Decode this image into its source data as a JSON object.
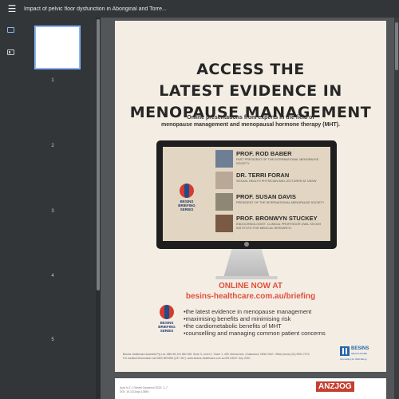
{
  "toolbar": {
    "title": "Impact of pelvic floor dysfunction in Aboriginal and Torre...",
    "menu_icon": "menu-icon"
  },
  "sidebar": {
    "thumbnail_icon": "thumbnail-view-icon",
    "outline_icon": "document-outline-icon",
    "page_numbers": [
      "1",
      "2",
      "3",
      "4",
      "5"
    ]
  },
  "ad": {
    "headline_1": "ACCESS THE",
    "headline_2": "LATEST EVIDENCE IN",
    "headline_3": "MENOPAUSE MANAGEMENT",
    "subhead_1": "Online presentations from experts in the field of",
    "subhead_2": "menopause management and menopausal hormone therapy (MHT).",
    "series_logo": [
      "BESINS",
      "BRIEFING",
      "SERIES"
    ],
    "speakers": [
      {
        "name": "PROF. ROD BABER",
        "role": "Past President of the International Menopause Society"
      },
      {
        "name": "DR. TERRI FORAN",
        "role": "Sexual Health Physician and Lecturer at UNSW"
      },
      {
        "name": "PROF. SUSAN DAVIS",
        "role": "President of the International Menopause Society"
      },
      {
        "name": "PROF.  BRONWYN STUCKEY",
        "role": "Endocrinologist. Clinical Professor UWA. Keogh Institute for Medical Research."
      }
    ],
    "online_1": "ONLINE NOW AT",
    "online_2": "besins-healthcare.com.au/briefing",
    "bullets": [
      "the latest evidence in menopause management",
      "maximising benefits and minimising risk",
      "the cardiometabolic benefits of MHT",
      "counselling and managing common patient concerns"
    ],
    "footer_1": "Besins Healthcare Australia Pty Ltd. ABN 66 104 860 065. Suite 3, Level 2, Tower 1, 495 Victoria Ave, Chatswood, NSW 2067. Office phone (02) 9904 7473.",
    "footer_2": "For medical information call 1800 BESINS (237 467). www.besins-healthcare.com.au BH-03037 July 2020.",
    "brand_1": "BESINS",
    "brand_2": "HEALTHCARE",
    "brand_3": "Innovating for Well-Being"
  },
  "page2": {
    "line_1": "Aust N Z J Obstet Gynaecol 2022; 1–7",
    "line_2": "DOI: 10.1111/ajo.13580",
    "journal": "ANZJOG"
  }
}
